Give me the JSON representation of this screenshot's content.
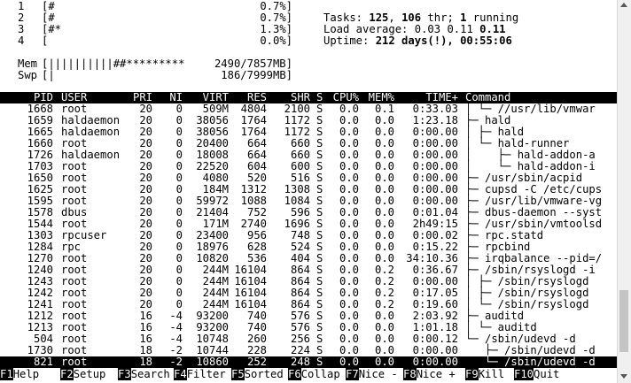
{
  "meters": {
    "cpus": [
      {
        "id": "1",
        "bar": "[#",
        "pct": "0.7%]"
      },
      {
        "id": "2",
        "bar": "[#",
        "pct": "0.7%]"
      },
      {
        "id": "3",
        "bar": "[#*",
        "pct": "1.3%]"
      },
      {
        "id": "4",
        "bar": "[",
        "pct": "0.0%]"
      }
    ],
    "mem": {
      "label": "Mem",
      "bar": "[||||||||||##*********",
      "value": "2490/7857MB]"
    },
    "swp": {
      "label": "Swp",
      "bar": "[|",
      "value": "186/7999MB]"
    }
  },
  "stats": {
    "tasks_label": "Tasks: ",
    "tasks": "125",
    "thr_sep": ", ",
    "thr": "106",
    "thr_label": " thr; ",
    "running": "1",
    "running_label": " running",
    "load_label": "Load average: ",
    "load1": "0.03",
    "load5": "0.11",
    "load15": "0.11",
    "uptime_label": "Uptime: ",
    "uptime": "212 days(!), 00:55:06"
  },
  "columns": [
    "PID",
    "USER",
    "PRI",
    "NI",
    "VIRT",
    "RES",
    "SHR",
    "S",
    "CPU%",
    "MEM%",
    "TIME+",
    "Command"
  ],
  "processes": [
    {
      "pid": "1668",
      "user": "root",
      "pri": "20",
      "ni": "0",
      "virt": "509M",
      "res": "4804",
      "shr": "2100",
      "s": "S",
      "cpu": "0.0",
      "mem": "0.1",
      "time": "0:33.03",
      "cmd": "│ └─ //usr/lib/vmwar"
    },
    {
      "pid": "1659",
      "user": "haldaemon",
      "pri": "20",
      "ni": "0",
      "virt": "38056",
      "res": "1764",
      "shr": "1172",
      "s": "S",
      "cpu": "0.0",
      "mem": "0.0",
      "time": "1:23.18",
      "cmd": "├─ hald"
    },
    {
      "pid": "1665",
      "user": "haldaemon",
      "pri": "20",
      "ni": "0",
      "virt": "38056",
      "res": "1764",
      "shr": "1172",
      "s": "S",
      "cpu": "0.0",
      "mem": "0.0",
      "time": "0:00.00",
      "cmd": "│ ├─ hald"
    },
    {
      "pid": "1660",
      "user": "root",
      "pri": "20",
      "ni": "0",
      "virt": "20400",
      "res": "664",
      "shr": "660",
      "s": "S",
      "cpu": "0.0",
      "mem": "0.0",
      "time": "0:00.00",
      "cmd": "│ └─ hald-runner"
    },
    {
      "pid": "1726",
      "user": "haldaemon",
      "pri": "20",
      "ni": "0",
      "virt": "18008",
      "res": "664",
      "shr": "660",
      "s": "S",
      "cpu": "0.0",
      "mem": "0.0",
      "time": "0:00.00",
      "cmd": "│    ├─ hald-addon-a"
    },
    {
      "pid": "1703",
      "user": "root",
      "pri": "20",
      "ni": "0",
      "virt": "22520",
      "res": "604",
      "shr": "600",
      "s": "S",
      "cpu": "0.0",
      "mem": "0.0",
      "time": "0:00.00",
      "cmd": "│    └─ hald-addon-i"
    },
    {
      "pid": "1650",
      "user": "root",
      "pri": "20",
      "ni": "0",
      "virt": "4080",
      "res": "520",
      "shr": "516",
      "s": "S",
      "cpu": "0.0",
      "mem": "0.0",
      "time": "0:00.00",
      "cmd": "├─ /usr/sbin/acpid"
    },
    {
      "pid": "1625",
      "user": "root",
      "pri": "20",
      "ni": "0",
      "virt": "184M",
      "res": "1312",
      "shr": "1308",
      "s": "S",
      "cpu": "0.0",
      "mem": "0.0",
      "time": "0:00.00",
      "cmd": "├─ cupsd -C /etc/cups"
    },
    {
      "pid": "1595",
      "user": "root",
      "pri": "20",
      "ni": "0",
      "virt": "59972",
      "res": "1088",
      "shr": "1084",
      "s": "S",
      "cpu": "0.0",
      "mem": "0.0",
      "time": "0:00.00",
      "cmd": "├─ /usr/lib/vmware-vg"
    },
    {
      "pid": "1578",
      "user": "dbus",
      "pri": "20",
      "ni": "0",
      "virt": "21404",
      "res": "752",
      "shr": "596",
      "s": "S",
      "cpu": "0.0",
      "mem": "0.0",
      "time": "0:01.04",
      "cmd": "├─ dbus-daemon --syst"
    },
    {
      "pid": "1544",
      "user": "root",
      "pri": "20",
      "ni": "0",
      "virt": "171M",
      "res": "2740",
      "shr": "1696",
      "s": "S",
      "cpu": "0.0",
      "mem": "0.0",
      "time": "2h49:15",
      "cmd": "├─ /usr/sbin/vmtoolsd"
    },
    {
      "pid": "1303",
      "user": "rpcuser",
      "pri": "20",
      "ni": "0",
      "virt": "23400",
      "res": "956",
      "shr": "748",
      "s": "S",
      "cpu": "0.0",
      "mem": "0.0",
      "time": "0:00.02",
      "cmd": "├─ rpc.statd"
    },
    {
      "pid": "1284",
      "user": "rpc",
      "pri": "20",
      "ni": "0",
      "virt": "18976",
      "res": "628",
      "shr": "524",
      "s": "S",
      "cpu": "0.0",
      "mem": "0.0",
      "time": "0:15.22",
      "cmd": "├─ rpcbind"
    },
    {
      "pid": "1270",
      "user": "root",
      "pri": "20",
      "ni": "0",
      "virt": "10820",
      "res": "536",
      "shr": "404",
      "s": "S",
      "cpu": "0.0",
      "mem": "0.0",
      "time": "34:10.36",
      "cmd": "├─ irqbalance --pid=/"
    },
    {
      "pid": "1240",
      "user": "root",
      "pri": "20",
      "ni": "0",
      "virt": "244M",
      "res": "16104",
      "shr": "864",
      "s": "S",
      "cpu": "0.0",
      "mem": "0.2",
      "time": "0:36.67",
      "cmd": "├─ /sbin/rsyslogd -i"
    },
    {
      "pid": "1243",
      "user": "root",
      "pri": "20",
      "ni": "0",
      "virt": "244M",
      "res": "16104",
      "shr": "864",
      "s": "S",
      "cpu": "0.0",
      "mem": "0.2",
      "time": "0:00.00",
      "cmd": "│ ├─ /sbin/rsyslogd"
    },
    {
      "pid": "1242",
      "user": "root",
      "pri": "20",
      "ni": "0",
      "virt": "244M",
      "res": "16104",
      "shr": "864",
      "s": "S",
      "cpu": "0.0",
      "mem": "0.2",
      "time": "0:17.05",
      "cmd": "│ ├─ /sbin/rsyslogd"
    },
    {
      "pid": "1241",
      "user": "root",
      "pri": "20",
      "ni": "0",
      "virt": "244M",
      "res": "16104",
      "shr": "864",
      "s": "S",
      "cpu": "0.0",
      "mem": "0.2",
      "time": "0:19.60",
      "cmd": "│ └─ /sbin/rsyslogd"
    },
    {
      "pid": "1212",
      "user": "root",
      "pri": "16",
      "ni": "-4",
      "virt": "93200",
      "res": "740",
      "shr": "576",
      "s": "S",
      "cpu": "0.0",
      "mem": "0.0",
      "time": "2:03.92",
      "cmd": "├─ auditd"
    },
    {
      "pid": "1213",
      "user": "root",
      "pri": "16",
      "ni": "-4",
      "virt": "93200",
      "res": "740",
      "shr": "576",
      "s": "S",
      "cpu": "0.0",
      "mem": "0.0",
      "time": "1:01.18",
      "cmd": "│ └─ auditd"
    },
    {
      "pid": "504",
      "user": "root",
      "pri": "16",
      "ni": "-4",
      "virt": "10748",
      "res": "260",
      "shr": "256",
      "s": "S",
      "cpu": "0.0",
      "mem": "0.0",
      "time": "0:00.12",
      "cmd": "└─ /sbin/udevd -d"
    },
    {
      "pid": "1730",
      "user": "root",
      "pri": "18",
      "ni": "-2",
      "virt": "10744",
      "res": "228",
      "shr": "224",
      "s": "S",
      "cpu": "0.0",
      "mem": "0.0",
      "time": "0:00.00",
      "cmd": "   ├─ /sbin/udevd -d"
    },
    {
      "pid": "821",
      "user": "root",
      "pri": "18",
      "ni": "-2",
      "virt": "10860",
      "res": "252",
      "shr": "248",
      "s": "S",
      "cpu": "0.0",
      "mem": "0.0",
      "time": "0:00.00",
      "cmd": "   └─ /sbin/udevd -d"
    }
  ],
  "selected_index": 22,
  "fkeys": [
    {
      "key": "F1",
      "label": "Help"
    },
    {
      "key": "F2",
      "label": "Setup"
    },
    {
      "key": "F3",
      "label": "Search"
    },
    {
      "key": "F4",
      "label": "Filter"
    },
    {
      "key": "F5",
      "label": "Sorted"
    },
    {
      "key": "F6",
      "label": "Collap"
    },
    {
      "key": "F7",
      "label": "Nice -"
    },
    {
      "key": "F8",
      "label": "Nice +"
    },
    {
      "key": "F9",
      "label": "Kill"
    },
    {
      "key": "F10",
      "label": "Quit"
    }
  ]
}
